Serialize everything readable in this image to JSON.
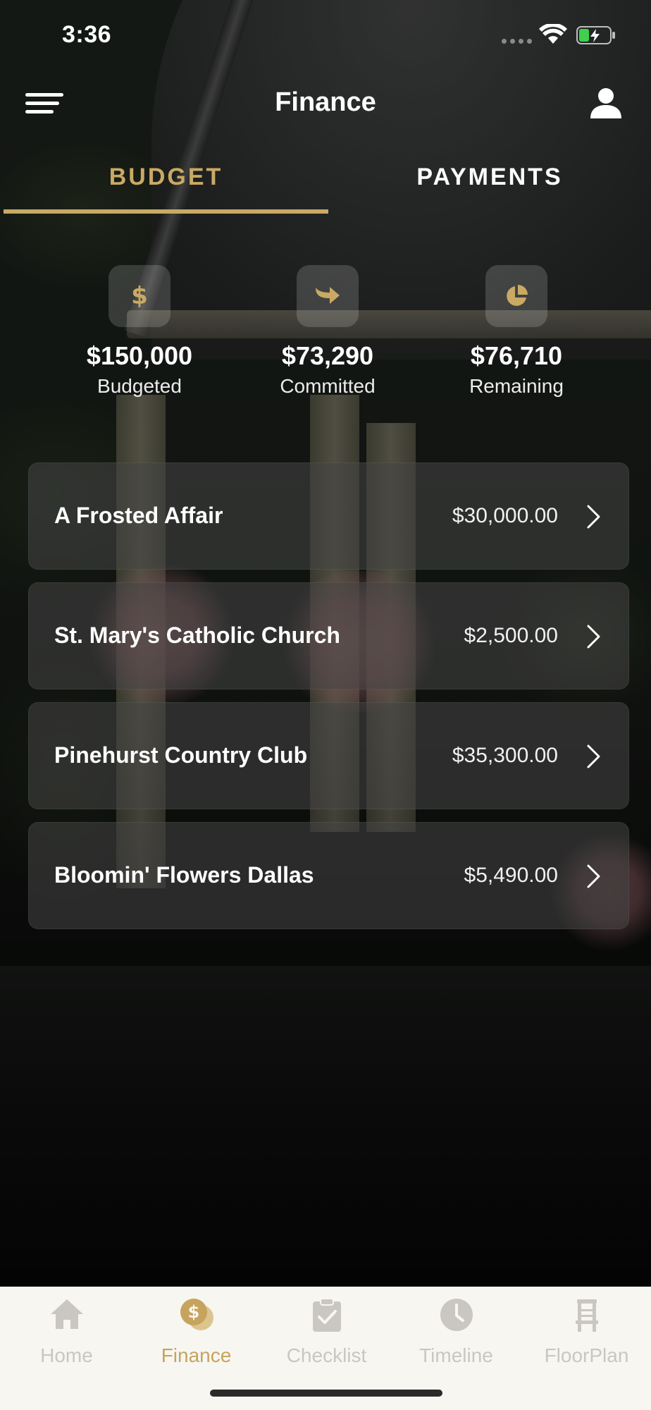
{
  "status_bar": {
    "time": "3:36"
  },
  "header": {
    "title": "Finance"
  },
  "tabs": [
    {
      "label": "BUDGET",
      "active": true
    },
    {
      "label": "PAYMENTS",
      "active": false
    }
  ],
  "stats": [
    {
      "icon": "dollar-icon",
      "value": "$150,000",
      "label": "Budgeted"
    },
    {
      "icon": "arrow-icon",
      "value": "$73,290",
      "label": "Committed"
    },
    {
      "icon": "pie-chart-icon",
      "value": "$76,710",
      "label": "Remaining"
    }
  ],
  "stat_icon_glyphs": {
    "dollar": "$"
  },
  "vendors": [
    {
      "name": "A Frosted Affair",
      "amount": "$30,000.00"
    },
    {
      "name": "St. Mary's Catholic Church",
      "amount": "$2,500.00"
    },
    {
      "name": "Pinehurst Country Club",
      "amount": "$35,300.00"
    },
    {
      "name": "Bloomin' Flowers Dallas",
      "amount": "$5,490.00"
    }
  ],
  "bottom_nav": [
    {
      "label": "Home",
      "icon": "home-icon",
      "active": false
    },
    {
      "label": "Finance",
      "icon": "finance-icon",
      "active": true
    },
    {
      "label": "Checklist",
      "icon": "checklist-icon",
      "active": false
    },
    {
      "label": "Timeline",
      "icon": "clock-icon",
      "active": false
    },
    {
      "label": "FloorPlan",
      "icon": "chair-icon",
      "active": false
    }
  ],
  "colors": {
    "accent_gold": "#c9a964",
    "tab_bar_bg": "#f7f6f1",
    "inactive_nav": "#cac7c1"
  }
}
